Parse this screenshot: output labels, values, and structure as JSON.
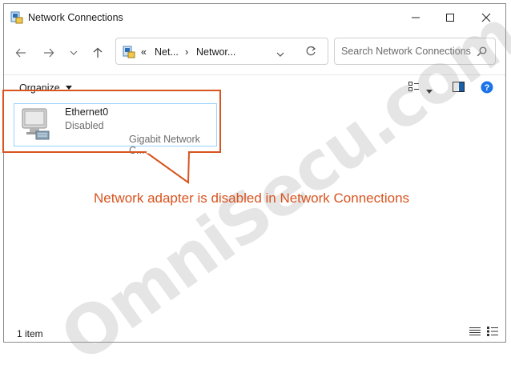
{
  "window": {
    "title": "Network Connections"
  },
  "navigation": {
    "back_label": "←",
    "forward_label": "→",
    "recent_label": "⌄",
    "up_label": "↑"
  },
  "address": {
    "overflow": "«",
    "segments": [
      "Net...",
      "Networ..."
    ],
    "separator": "›"
  },
  "search": {
    "placeholder": "Search Network Connections"
  },
  "toolbar": {
    "organize_label": "Organize"
  },
  "items": [
    {
      "name": "Ethernet0",
      "status": "Disabled",
      "device": "Gigabit Network C..."
    }
  ],
  "annotation": {
    "text": "Network adapter is disabled in Network Connections"
  },
  "watermark": {
    "text": "OmniSecu.com"
  },
  "statusbar": {
    "count": "1 item"
  },
  "colors": {
    "callout": "#d9531e",
    "selection_border": "#99d1ff",
    "help": "#1a73e8"
  },
  "icons": [
    "network-connections-icon",
    "minimize-icon",
    "maximize-icon",
    "close-icon",
    "back-arrow-icon",
    "forward-arrow-icon",
    "chevron-down-icon",
    "up-arrow-icon",
    "refresh-icon",
    "search-icon",
    "view-options-icon",
    "preview-pane-icon",
    "help-icon",
    "network-adapter-icon",
    "details-view-icon",
    "tiles-view-icon"
  ]
}
